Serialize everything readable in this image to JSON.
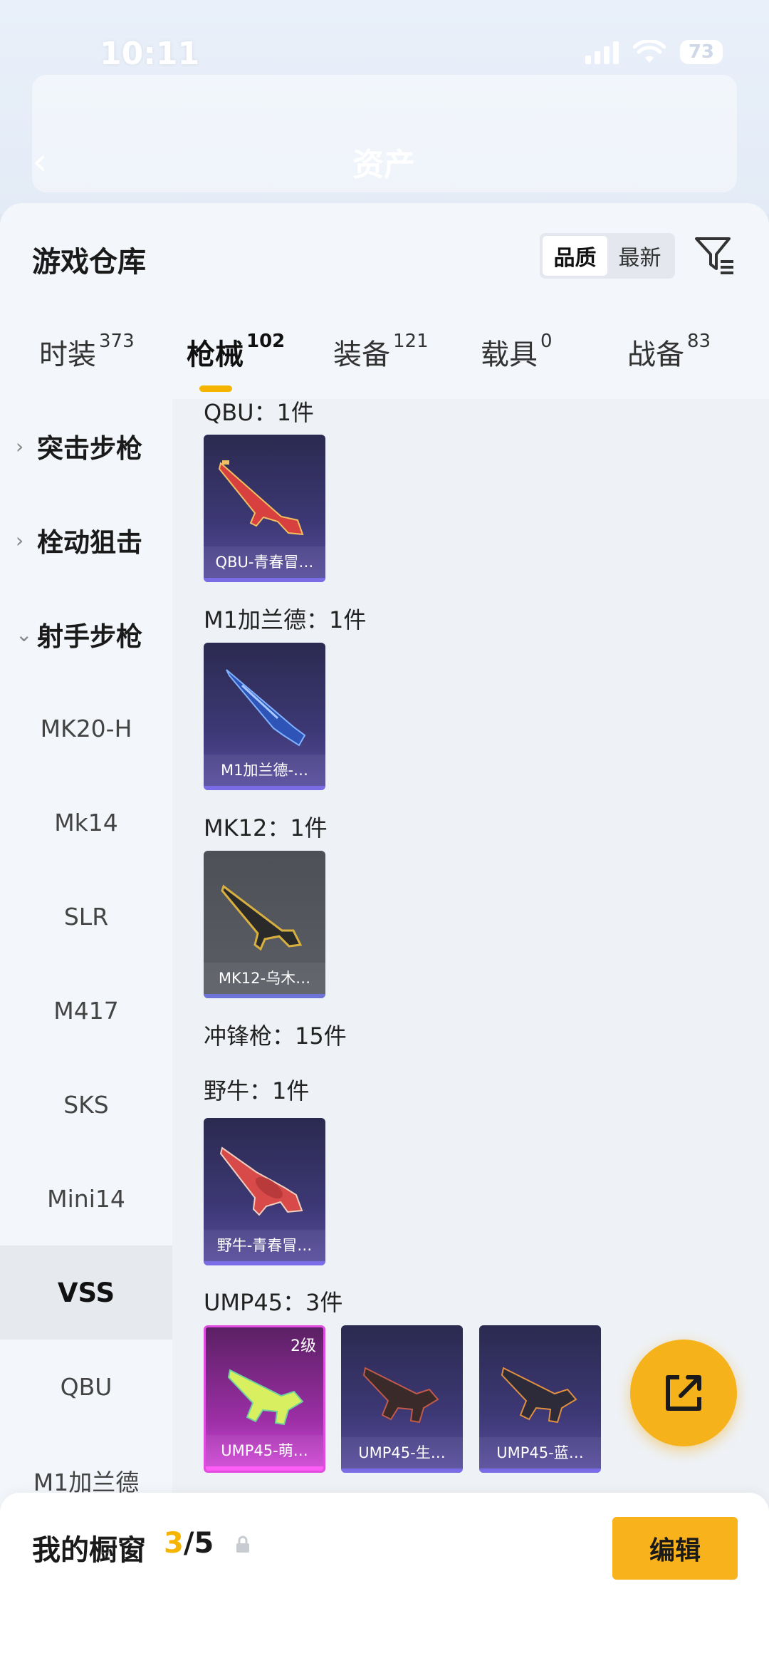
{
  "status": {
    "time": "10:11",
    "battery": "73"
  },
  "page": {
    "back_title": "资产"
  },
  "warehouse": {
    "title": "游戏仓库",
    "sort_options": [
      "品质",
      "最新"
    ],
    "sort_selected": "品质"
  },
  "tabs": [
    {
      "label": "时装",
      "count": "373"
    },
    {
      "label": "枪械",
      "count": "102",
      "active": true
    },
    {
      "label": "装备",
      "count": "121"
    },
    {
      "label": "载具",
      "count": "0"
    },
    {
      "label": "战备",
      "count": "83"
    }
  ],
  "sidebar": {
    "categories": [
      {
        "label": "突击步枪",
        "expanded": false
      },
      {
        "label": "栓动狙击",
        "expanded": false
      },
      {
        "label": "射手步枪",
        "expanded": true
      }
    ],
    "subitems": [
      "MK20-H",
      "Mk14",
      "SLR",
      "M417",
      "SKS",
      "Mini14",
      "VSS",
      "QBU",
      "M1加兰德"
    ],
    "active_subitem": "VSS"
  },
  "content": {
    "sections": [
      {
        "label": "QBU：1件",
        "items": [
          {
            "name": "QBU-青春冒…",
            "rarity": "purple",
            "icon": "qbu-rifle-icon"
          }
        ]
      },
      {
        "label": "M1加兰德：1件",
        "items": [
          {
            "name": "M1加兰德-…",
            "rarity": "purple",
            "icon": "m1-garand-rifle-icon"
          }
        ]
      },
      {
        "label": "MK12：1件",
        "items": [
          {
            "name": "MK12-乌木…",
            "rarity": "grey",
            "icon": "mk12-rifle-icon"
          }
        ]
      },
      {
        "label": "冲锋枪：15件",
        "items": []
      },
      {
        "label": "野牛：1件",
        "items": [
          {
            "name": "野牛-青春冒…",
            "rarity": "purple",
            "icon": "bizon-smg-icon"
          }
        ]
      },
      {
        "label": "UMP45：3件",
        "items": [
          {
            "name": "UMP45-萌…",
            "rarity": "pink",
            "level": "2级",
            "icon": "ump45-smg-icon"
          },
          {
            "name": "UMP45-生…",
            "rarity": "purple",
            "icon": "ump45-smg-icon"
          },
          {
            "name": "UMP45-蓝…",
            "rarity": "purple",
            "icon": "ump45-smg-icon"
          }
        ]
      }
    ]
  },
  "showcase": {
    "title": "我的橱窗",
    "current": "3",
    "total": "/5",
    "edit_label": "编辑"
  },
  "colors": {
    "accent": "#f5b400",
    "button": "#f7b21c",
    "purple_card": "#3d3875",
    "pink_card": "#d24bd8"
  }
}
